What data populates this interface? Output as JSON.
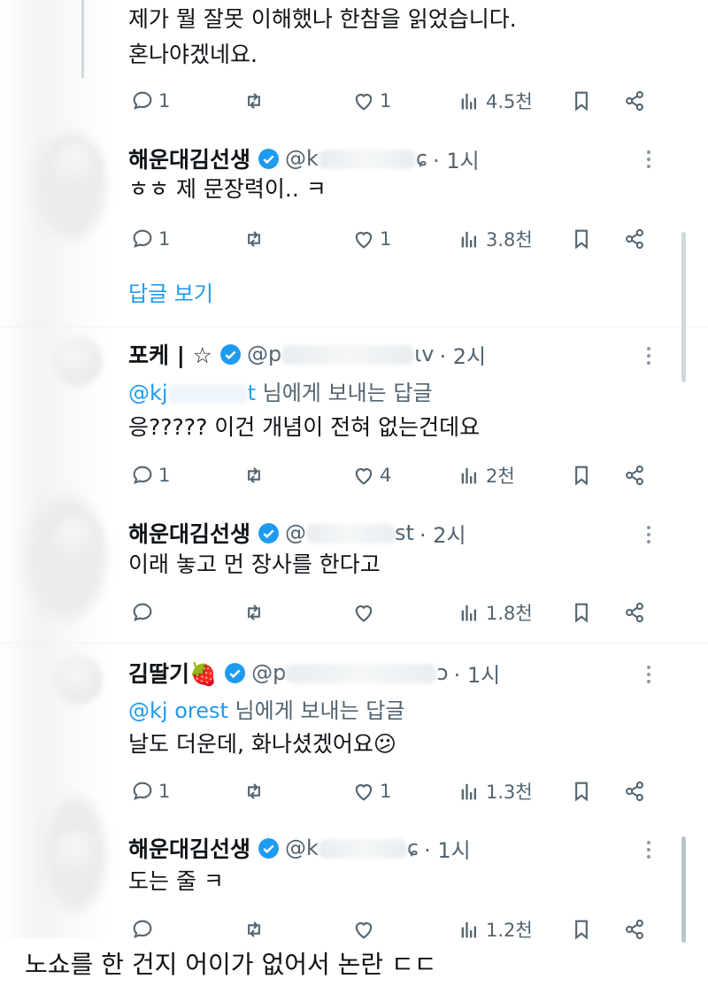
{
  "top_reply": {
    "lines": [
      "제가 뭘 잘못 이해했나 한참을 읽었습니다.",
      "혼나야겠네요."
    ],
    "replies": "1",
    "likes": "1",
    "views": "4.5천"
  },
  "tweets": [
    {
      "name": "해운대김선생",
      "handle_start": "@k",
      "handle_end": "ɕ",
      "time": "· 1시",
      "reply_to": null,
      "text": "ㅎㅎ 제 문장력이.. ㅋ",
      "replies": "1",
      "likes": "1",
      "views": "3.8천",
      "show_replies": "답글 보기"
    },
    {
      "name": "포케 | ☆",
      "handle_start": "@p",
      "handle_end": "ιv",
      "time": "· 2시",
      "reply_to": {
        "handle": "@kj",
        "suffix": "님에게 보내는 답글"
      },
      "text": "응????? 이건 개념이 전혀 없는건데요",
      "replies": "1",
      "likes": "4",
      "views": "2천"
    },
    {
      "name": "해운대김선생",
      "handle_start": "@",
      "handle_end": "st",
      "time": "· 2시",
      "reply_to": null,
      "text": "이래 놓고 먼 장사를 한다고",
      "replies": "",
      "likes": "",
      "views": "1.8천"
    },
    {
      "name": "김딸기🍓",
      "handle_start": "@p",
      "handle_end": "ɔ",
      "time": "· 1시",
      "reply_to": {
        "handle": "@kj   orest",
        "suffix": "님에게 보내는 답글"
      },
      "text": "날도 더운데, 화나셨겠어요😕",
      "replies": "1",
      "likes": "1",
      "views": "1.3천"
    },
    {
      "name": "해운대김선생",
      "handle_start": "@k",
      "handle_end": "ɕ",
      "time": "· 1시",
      "reply_to": null,
      "text": "도는 줄 ㅋ",
      "replies": "",
      "likes": "",
      "views": "1.2천"
    }
  ],
  "caption": "노쇼를 한 건지 어이가 없어서 논란 ㄷㄷ",
  "colors": {
    "accent": "#1d9bf0",
    "secondary_text": "#536471",
    "primary_text": "#0f1419"
  }
}
